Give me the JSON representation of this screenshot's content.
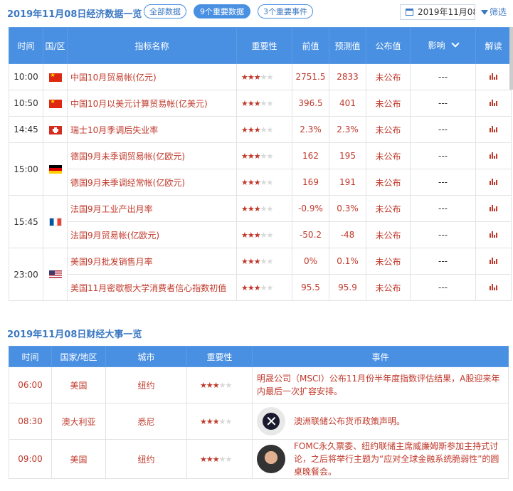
{
  "header": {
    "title": "2019年11月08日经济数据一览",
    "tabs": [
      "全部数据",
      "9个重要数据",
      "3个重要事件"
    ],
    "active_tab": 1,
    "date": "2019年11月08",
    "filter_label": "筛选"
  },
  "econ_table": {
    "columns": [
      "时间",
      "国/区",
      "指标名称",
      "重要性",
      "前值",
      "预测值",
      "公布值",
      "影响",
      "解读"
    ],
    "rows": [
      {
        "time": "10:00",
        "flag": "cn",
        "name": "中国10月贸易帐(亿元)",
        "stars": 3,
        "prev": "2751.5",
        "forecast": "2833",
        "actual": "未公布",
        "impact": "---"
      },
      {
        "time": "10:50",
        "flag": "cn",
        "name": "中国10月以美元计算贸易帐(亿美元)",
        "stars": 3,
        "prev": "396.5",
        "forecast": "401",
        "actual": "未公布",
        "impact": "---"
      },
      {
        "time": "14:45",
        "flag": "ch",
        "name": "瑞士10月季调后失业率",
        "stars": 3,
        "prev": "2.3%",
        "forecast": "2.3%",
        "actual": "未公布",
        "impact": "---"
      },
      {
        "time": "15:00",
        "flag": "de",
        "name": "德国9月未季调贸易帐(亿欧元)",
        "stars": 3,
        "prev": "162",
        "forecast": "195",
        "actual": "未公布",
        "impact": "---"
      },
      {
        "time": "15:00",
        "flag": "de",
        "name": "德国9月未季调经常帐(亿欧元)",
        "stars": 3,
        "prev": "169",
        "forecast": "191",
        "actual": "未公布",
        "impact": "---"
      },
      {
        "time": "15:45",
        "flag": "fr",
        "name": "法国9月工业产出月率",
        "stars": 3,
        "prev": "-0.9%",
        "forecast": "0.3%",
        "actual": "未公布",
        "impact": "---"
      },
      {
        "time": "15:45",
        "flag": "fr",
        "name": "法国9月贸易帐(亿欧元)",
        "stars": 3,
        "prev": "-50.2",
        "forecast": "-48",
        "actual": "未公布",
        "impact": "---"
      },
      {
        "time": "23:00",
        "flag": "us",
        "name": "美国9月批发销售月率",
        "stars": 3,
        "prev": "0%",
        "forecast": "0.1%",
        "actual": "未公布",
        "impact": "---"
      },
      {
        "time": "23:00",
        "flag": "us",
        "name": "美国11月密歇根大学消费者信心指数初值",
        "stars": 3,
        "prev": "95.5",
        "forecast": "95.9",
        "actual": "未公布",
        "impact": "---"
      }
    ]
  },
  "events": {
    "title": "2019年11月08日财经大事一览",
    "columns": [
      "时间",
      "国家/地区",
      "城市",
      "重要性",
      "事件"
    ],
    "rows": [
      {
        "time": "06:00",
        "country": "美国",
        "city": "纽约",
        "stars": 3,
        "avatar": "",
        "event": "明晟公司（MSCI）公布11月份半年度指数评估结果，A股迎来年内最后一次扩容安排。"
      },
      {
        "time": "08:30",
        "country": "澳大利亚",
        "city": "悉尼",
        "stars": 3,
        "avatar": "rba-logo",
        "event": "澳洲联储公布货币政策声明。"
      },
      {
        "time": "09:00",
        "country": "美国",
        "city": "纽约",
        "stars": 3,
        "avatar": "fed-official-photo",
        "event": "FOMC永久票委、纽约联储主席威廉姆斯参加主持式讨论，之后将举行主题为“应对全球金融系统脆弱性”的圆桌晚餐会。"
      }
    ]
  },
  "colors": {
    "accent": "#4a90e2",
    "red": "#c0392b",
    "title": "#3b78c2"
  }
}
